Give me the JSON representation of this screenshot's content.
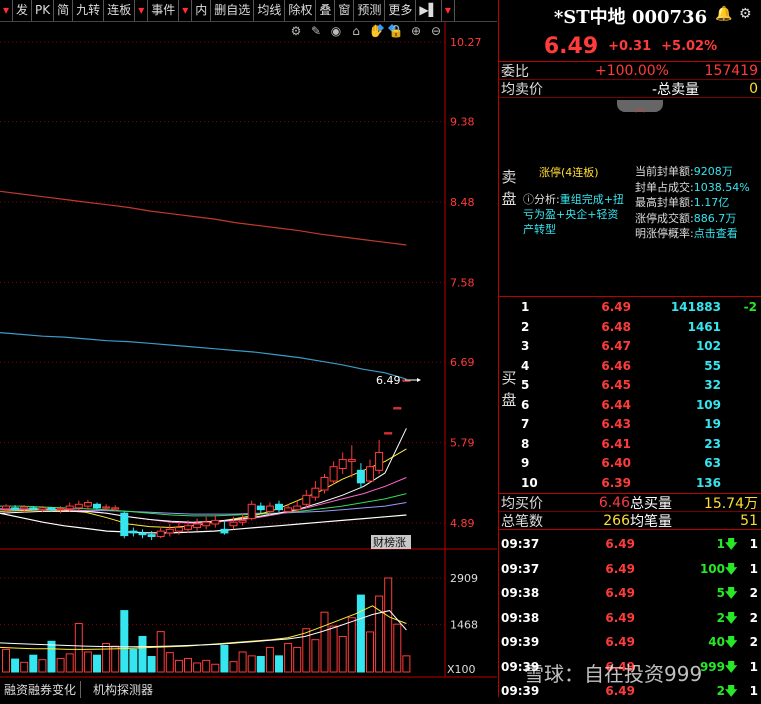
{
  "toolbar": {
    "items": [
      {
        "label": "▾",
        "dd": true
      },
      {
        "label": "发"
      },
      {
        "label": "PK"
      },
      {
        "label": "简"
      },
      {
        "label": "九转"
      },
      {
        "label": "连板"
      },
      {
        "label": "▾",
        "dd": true
      },
      {
        "label": "事件"
      },
      {
        "label": "▾",
        "dd": true
      },
      {
        "label": "内"
      },
      {
        "label": "删自选"
      },
      {
        "label": "均线"
      },
      {
        "label": "除权"
      },
      {
        "label": "叠"
      },
      {
        "label": "窗"
      },
      {
        "label": "预测"
      },
      {
        "label": "更多"
      },
      {
        "label": "▶▌"
      },
      {
        "label": "▾",
        "dd": true
      }
    ]
  },
  "chart_tools": {
    "icons": [
      "gear-icon",
      "pen-icon",
      "eye-icon",
      "lock-open-icon",
      "hand-icon",
      "lock-icon",
      "zoom-in-icon",
      "zoom-out-icon"
    ]
  },
  "price_axis": [
    "10.27",
    "9.38",
    "8.48",
    "7.58",
    "6.69",
    "5.79",
    "4.89"
  ],
  "volume_axis": [
    "2909",
    "1468"
  ],
  "volume_unit": "X100",
  "last_price_label": "6.49",
  "event_label": "财榜涨",
  "bottom_tabs": [
    "融资融券变化",
    "机构探测器"
  ],
  "stock": {
    "name": "*ST中地 000736",
    "price": "6.49",
    "change": "+0.31",
    "pct": "+5.02%"
  },
  "weibi": {
    "label": "委比",
    "pct": "+100.00%",
    "vol": "157419"
  },
  "avg_sell": {
    "label": "均卖价",
    "mid": "-总卖量",
    "val": "0"
  },
  "sell_panel": {
    "side_label": "卖盘",
    "limit_title": "涨停(4连板)",
    "analysis_prefix": "分析:",
    "analysis_text": "重组完成+扭亏为盈+央企+轻资产转型",
    "stats": [
      {
        "k": "当前封单额:",
        "v": "9208万"
      },
      {
        "k": "封单占成交:",
        "v": "1038.54%"
      },
      {
        "k": "最高封单额:",
        "v": "1.17亿"
      },
      {
        "k": "涨停成交额:",
        "v": "886.7万"
      },
      {
        "k": "明涨停概率:",
        "v": "点击查看"
      }
    ]
  },
  "buy_side_label": "买盘",
  "bids": [
    {
      "lvl": "1",
      "price": "6.49",
      "vol": "141883",
      "chg": "-2"
    },
    {
      "lvl": "2",
      "price": "6.48",
      "vol": "1461",
      "chg": ""
    },
    {
      "lvl": "3",
      "price": "6.47",
      "vol": "102",
      "chg": ""
    },
    {
      "lvl": "4",
      "price": "6.46",
      "vol": "55",
      "chg": ""
    },
    {
      "lvl": "5",
      "price": "6.45",
      "vol": "32",
      "chg": ""
    },
    {
      "lvl": "6",
      "price": "6.44",
      "vol": "109",
      "chg": ""
    },
    {
      "lvl": "7",
      "price": "6.43",
      "vol": "19",
      "chg": ""
    },
    {
      "lvl": "8",
      "price": "6.41",
      "vol": "23",
      "chg": ""
    },
    {
      "lvl": "9",
      "price": "6.40",
      "vol": "63",
      "chg": ""
    },
    {
      "lvl": "10",
      "price": "6.39",
      "vol": "136",
      "chg": ""
    }
  ],
  "avg_buy": {
    "label": "均买价",
    "val": "6.46",
    "mid": "总买量",
    "vol": "15.74万"
  },
  "total_trades": {
    "label": "总笔数",
    "val": "266",
    "mid": "均笔量",
    "vol": "51"
  },
  "trades": [
    {
      "time": "09:37",
      "price": "6.49",
      "vol": "1",
      "n": "1"
    },
    {
      "time": "09:37",
      "price": "6.49",
      "vol": "100",
      "n": "1"
    },
    {
      "time": "09:38",
      "price": "6.49",
      "vol": "5",
      "n": "2"
    },
    {
      "time": "09:38",
      "price": "6.49",
      "vol": "2",
      "n": "2"
    },
    {
      "time": "09:39",
      "price": "6.49",
      "vol": "40",
      "n": "2"
    },
    {
      "time": "09:39",
      "price": "6.49",
      "vol": "999",
      "n": "1"
    },
    {
      "time": "09:39",
      "price": "6.49",
      "vol": "2",
      "n": "1"
    }
  ],
  "watermark": "雪球：自在投资999",
  "colors": {
    "up": "#ff3b3b",
    "down": "#35e6f0",
    "ma_red": "#c0392b",
    "ma_blue": "#3a9bc9",
    "ma_white": "#ffffff",
    "ma_yellow": "#ffee33",
    "ma_pink": "#ff66cc",
    "ma_green": "#33dd55",
    "ma_violet": "#9999ff"
  },
  "chart_data": {
    "type": "candlestick",
    "price_range": [
      4.6,
      10.27
    ],
    "candles": [
      [
        5.05,
        5.08,
        5.0,
        5.1
      ],
      [
        5.06,
        5.05,
        5.02,
        5.09
      ],
      [
        5.05,
        5.07,
        5.01,
        5.09
      ],
      [
        5.06,
        5.05,
        5.03,
        5.08
      ],
      [
        5.04,
        5.06,
        5.01,
        5.08
      ],
      [
        5.06,
        5.04,
        5.02,
        5.07
      ],
      [
        5.04,
        5.05,
        5.0,
        5.08
      ],
      [
        5.05,
        5.08,
        5.02,
        5.12
      ],
      [
        5.06,
        5.1,
        5.03,
        5.14
      ],
      [
        5.08,
        5.12,
        5.04,
        5.15
      ],
      [
        5.1,
        5.06,
        5.04,
        5.12
      ],
      [
        5.06,
        5.07,
        5.03,
        5.1
      ],
      [
        5.05,
        5.06,
        5.02,
        5.09
      ],
      [
        5.0,
        4.75,
        4.72,
        5.02
      ],
      [
        4.8,
        4.78,
        4.74,
        4.84
      ],
      [
        4.78,
        4.76,
        4.72,
        4.82
      ],
      [
        4.76,
        4.74,
        4.7,
        4.8
      ],
      [
        4.74,
        4.8,
        4.72,
        4.85
      ],
      [
        4.78,
        4.82,
        4.74,
        4.88
      ],
      [
        4.8,
        4.84,
        4.76,
        4.9
      ],
      [
        4.82,
        4.86,
        4.78,
        4.92
      ],
      [
        4.84,
        4.88,
        4.8,
        4.94
      ],
      [
        4.86,
        4.9,
        4.82,
        4.96
      ],
      [
        4.88,
        4.92,
        4.84,
        4.98
      ],
      [
        4.82,
        4.78,
        4.76,
        4.92
      ],
      [
        4.86,
        4.9,
        4.82,
        4.96
      ],
      [
        4.9,
        4.92,
        4.86,
        5.0
      ],
      [
        4.94,
        5.1,
        4.92,
        5.14
      ],
      [
        5.08,
        5.04,
        5.0,
        5.12
      ],
      [
        5.02,
        5.08,
        4.98,
        5.12
      ],
      [
        5.1,
        5.04,
        5.0,
        5.14
      ],
      [
        5.02,
        5.06,
        5.0,
        5.1
      ],
      [
        5.04,
        5.08,
        5.01,
        5.14
      ],
      [
        5.1,
        5.2,
        5.06,
        5.26
      ],
      [
        5.18,
        5.28,
        5.14,
        5.36
      ],
      [
        5.26,
        5.4,
        5.22,
        5.44
      ],
      [
        5.36,
        5.52,
        5.32,
        5.58
      ],
      [
        5.5,
        5.6,
        5.44,
        5.68
      ],
      [
        5.58,
        5.6,
        5.4,
        5.76
      ],
      [
        5.48,
        5.34,
        5.28,
        5.56
      ],
      [
        5.36,
        5.52,
        5.34,
        5.6
      ],
      [
        5.48,
        5.68,
        5.44,
        5.82
      ],
      [
        5.9,
        5.9,
        5.9,
        5.9
      ],
      [
        6.18,
        6.18,
        6.18,
        6.18
      ],
      [
        6.49,
        6.49,
        6.49,
        6.49
      ]
    ],
    "ma_lines": {
      "ma_red": [
        8.6,
        8.57,
        8.54,
        8.51,
        8.48,
        8.45,
        8.42,
        8.38,
        8.35,
        8.32,
        8.29,
        8.25,
        8.22,
        8.19,
        8.16,
        8.12,
        8.09,
        8.06,
        8.03,
        8.0
      ],
      "ma_blue": [
        7.02,
        7.0,
        6.98,
        6.97,
        6.95,
        6.93,
        6.92,
        6.9,
        6.88,
        6.86,
        6.84,
        6.82,
        6.8,
        6.77,
        6.74,
        6.7,
        6.66,
        6.61,
        6.57,
        6.5
      ],
      "ma_white": [
        5.0,
        4.95,
        4.9,
        4.86,
        4.83,
        4.8,
        4.79,
        4.78,
        4.78,
        4.79,
        4.8,
        4.82,
        4.84,
        4.86,
        4.88,
        4.9,
        4.92,
        4.94,
        4.96,
        4.98
      ],
      "ma_yellow": [
        5.02,
        5.03,
        5.04,
        5.03,
        5.01,
        4.95,
        4.88,
        4.85,
        4.84,
        4.86,
        4.9,
        4.94,
        4.98,
        5.05,
        5.15,
        5.25,
        5.38,
        5.48,
        5.58,
        5.72
      ],
      "ma_pink": [
        5.05,
        5.05,
        5.05,
        5.04,
        5.03,
        5.0,
        4.96,
        4.93,
        4.9,
        4.89,
        4.9,
        4.92,
        4.95,
        4.99,
        5.04,
        5.1,
        5.16,
        5.22,
        5.3,
        5.4
      ],
      "ma_green": [
        5.08,
        5.08,
        5.07,
        5.06,
        5.05,
        5.04,
        5.02,
        5.0,
        4.98,
        4.97,
        4.97,
        4.98,
        4.99,
        5.0,
        5.02,
        5.05,
        5.08,
        5.12,
        5.16,
        5.22
      ],
      "ma_violet": [
        5.04,
        5.04,
        5.04,
        5.04,
        5.03,
        5.03,
        5.02,
        5.01,
        5.0,
        4.99,
        4.99,
        4.99,
        5.0,
        5.0,
        5.01,
        5.02,
        5.04,
        5.06,
        5.08,
        5.12
      ],
      "ma_gold": [
        5.0,
        5.01,
        5.02,
        5.02,
        5.02,
        5.0,
        4.96,
        4.93,
        4.91,
        4.9,
        4.91,
        4.93,
        4.96,
        5.0,
        5.05,
        5.12,
        5.2,
        5.3,
        5.45,
        5.95
      ]
    },
    "volume_range": [
      0,
      2909
    ],
    "volumes": [
      700,
      400,
      300,
      520,
      380,
      950,
      420,
      560,
      1500,
      620,
      520,
      880,
      800,
      1900,
      700,
      1100,
      480,
      1250,
      600,
      360,
      420,
      280,
      360,
      240,
      820,
      320,
      620,
      500,
      480,
      760,
      500,
      880,
      760,
      1340,
      1000,
      1850,
      1420,
      1100,
      1680,
      2380,
      1240,
      2350,
      2909,
      1480,
      500
    ],
    "vol_ma_yellow": [
      760,
      740,
      720,
      720,
      700,
      700,
      710,
      720,
      740,
      760,
      780,
      800,
      840,
      880,
      920,
      960,
      1000,
      1060,
      1200,
      1400,
      1600,
      1800,
      2050,
      1700,
      1500
    ],
    "vol_ma_white": [
      900,
      880,
      860,
      840,
      820,
      800,
      790,
      780,
      780,
      790,
      800,
      820,
      840,
      860,
      900,
      940,
      980,
      1020,
      1100,
      1250,
      1420,
      1600,
      1780,
      1900,
      1300
    ]
  }
}
